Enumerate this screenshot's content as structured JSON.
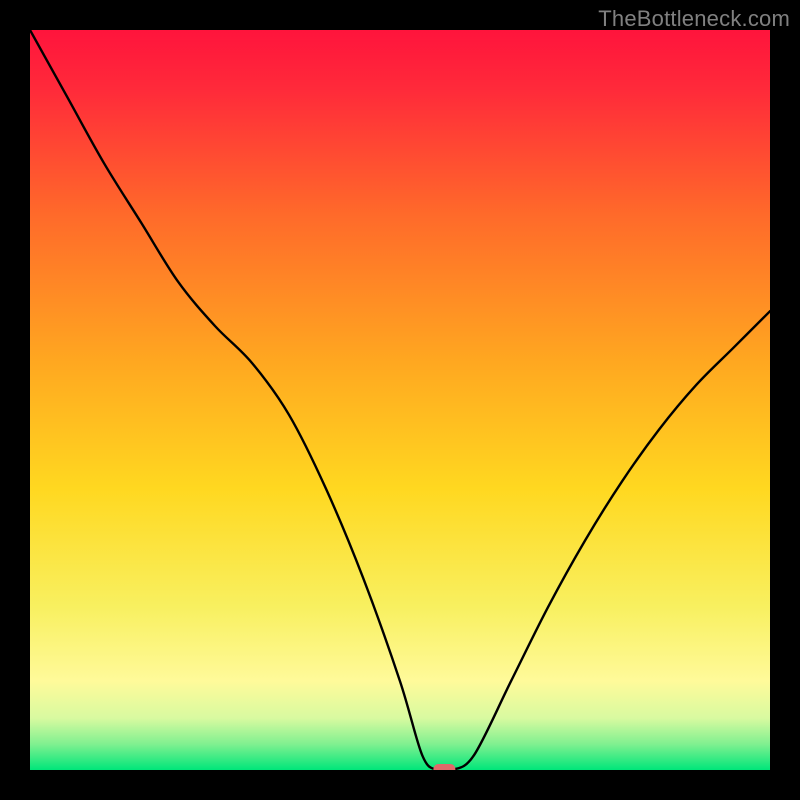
{
  "watermark": "TheBottleneck.com",
  "colors": {
    "frame": "#000000",
    "top": "#ff143c",
    "mid": "#ffd820",
    "pale": "#fffa9a",
    "bottom": "#00e67a",
    "line": "#000000",
    "marker": "#e06a6a"
  },
  "chart_data": {
    "type": "line",
    "title": "",
    "xlabel": "",
    "ylabel": "",
    "xlim": [
      0,
      100
    ],
    "ylim": [
      0,
      100
    ],
    "x": [
      0,
      5,
      10,
      15,
      20,
      25,
      30,
      35,
      40,
      45,
      50,
      53,
      55,
      57,
      60,
      65,
      70,
      75,
      80,
      85,
      90,
      95,
      100
    ],
    "y": [
      100,
      91,
      82,
      74,
      66,
      60,
      55,
      48,
      38,
      26,
      12,
      2,
      0,
      0,
      2,
      12,
      22,
      31,
      39,
      46,
      52,
      57,
      62
    ],
    "marker": {
      "x": 56,
      "y": 0
    },
    "annotations": []
  }
}
